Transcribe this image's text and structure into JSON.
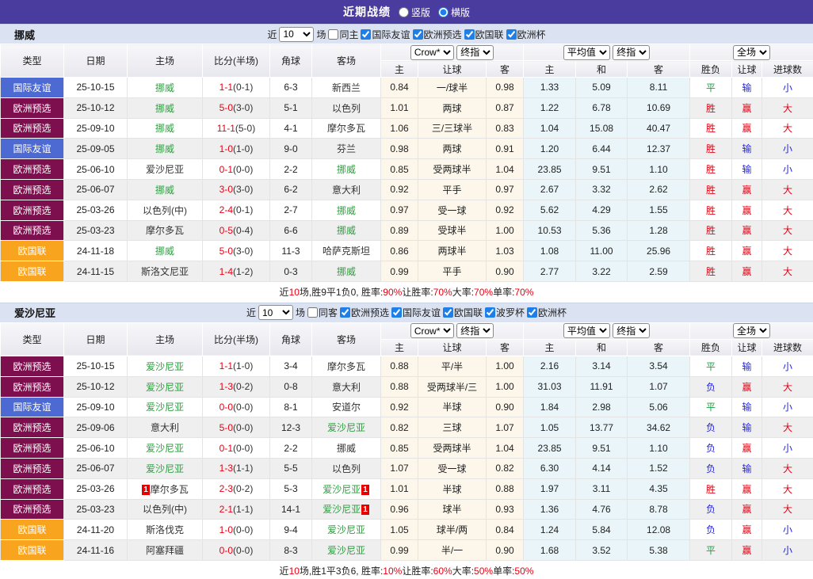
{
  "title_bar": {
    "title": "近期战绩",
    "options": [
      {
        "label": "竖版",
        "selected": false
      },
      {
        "label": "横版",
        "selected": true
      }
    ]
  },
  "colors": {
    "title_bg": "#4a3c9f",
    "filter_bg": "#dbe2f1",
    "type_friendly": "#4d6ad3",
    "type_qualifier": "#7e0f4e",
    "type_nations": "#f8a41e",
    "focus_team": "#2f9e41",
    "win_red": "#e60012",
    "lose_blue": "#2626d8",
    "draw_green": "#1d9e3e",
    "odds_bg": "#fcf7ea",
    "avg_bg": "#e9f5f9"
  },
  "table_header": {
    "static": [
      "类型",
      "日期",
      "主场",
      "比分(半场)",
      "角球",
      "客场"
    ],
    "selects": {
      "crow": "Crow*",
      "final1": "终指",
      "avg": "平均值",
      "final2": "终指",
      "scope": "全场"
    },
    "sub": [
      "主",
      "让球",
      "客",
      "主",
      "和",
      "客",
      "胜负",
      "让球",
      "进球数"
    ]
  },
  "tables": [
    {
      "team": "挪威",
      "filter": {
        "near_label": "近",
        "count": "10",
        "games_label": "场",
        "same_label": "同主",
        "same_checked": false,
        "leagues": [
          {
            "label": "国际友谊",
            "checked": true
          },
          {
            "label": "欧洲预选",
            "checked": true
          },
          {
            "label": "欧国联",
            "checked": true
          },
          {
            "label": "欧洲杯",
            "checked": true
          }
        ]
      },
      "rows": [
        {
          "type": "国际友谊",
          "type_color": "blue",
          "date": "25-10-15",
          "home": "挪威",
          "home_focus": true,
          "home_card": "",
          "score": "1-1",
          "half": "(0-1)",
          "corner": "6-3",
          "away": "新西兰",
          "away_focus": false,
          "away_card": "",
          "crow": [
            "0.84",
            "一/球半",
            "0.98"
          ],
          "avg": [
            "1.33",
            "5.09",
            "8.11"
          ],
          "outcome": [
            [
              "平",
              "g"
            ],
            [
              "输",
              "b"
            ],
            [
              "小",
              "b"
            ]
          ]
        },
        {
          "type": "欧洲预选",
          "type_color": "maroon",
          "date": "25-10-12",
          "home": "挪威",
          "home_focus": true,
          "home_card": "",
          "score": "5-0",
          "half": "(3-0)",
          "corner": "5-1",
          "away": "以色列",
          "away_focus": false,
          "away_card": "",
          "crow": [
            "1.01",
            "两球",
            "0.87"
          ],
          "avg": [
            "1.22",
            "6.78",
            "10.69"
          ],
          "outcome": [
            [
              "胜",
              "r"
            ],
            [
              "赢",
              "r"
            ],
            [
              "大",
              "r"
            ]
          ]
        },
        {
          "type": "欧洲预选",
          "type_color": "maroon",
          "date": "25-09-10",
          "home": "挪威",
          "home_focus": true,
          "home_card": "",
          "score": "11-1",
          "half": "(5-0)",
          "corner": "4-1",
          "away": "摩尔多瓦",
          "away_focus": false,
          "away_card": "",
          "crow": [
            "1.06",
            "三/三球半",
            "0.83"
          ],
          "avg": [
            "1.04",
            "15.08",
            "40.47"
          ],
          "outcome": [
            [
              "胜",
              "r"
            ],
            [
              "赢",
              "r"
            ],
            [
              "大",
              "r"
            ]
          ]
        },
        {
          "type": "国际友谊",
          "type_color": "blue",
          "date": "25-09-05",
          "home": "挪威",
          "home_focus": true,
          "home_card": "",
          "score": "1-0",
          "half": "(1-0)",
          "corner": "9-0",
          "away": "芬兰",
          "away_focus": false,
          "away_card": "",
          "crow": [
            "0.98",
            "两球",
            "0.91"
          ],
          "avg": [
            "1.20",
            "6.44",
            "12.37"
          ],
          "outcome": [
            [
              "胜",
              "r"
            ],
            [
              "输",
              "b"
            ],
            [
              "小",
              "b"
            ]
          ]
        },
        {
          "type": "欧洲预选",
          "type_color": "maroon",
          "date": "25-06-10",
          "home": "爱沙尼亚",
          "home_focus": false,
          "home_card": "",
          "score": "0-1",
          "half": "(0-0)",
          "corner": "2-2",
          "away": "挪威",
          "away_focus": true,
          "away_card": "",
          "crow": [
            "0.85",
            "受两球半",
            "1.04"
          ],
          "avg": [
            "23.85",
            "9.51",
            "1.10"
          ],
          "outcome": [
            [
              "胜",
              "r"
            ],
            [
              "输",
              "b"
            ],
            [
              "小",
              "b"
            ]
          ]
        },
        {
          "type": "欧洲预选",
          "type_color": "maroon",
          "date": "25-06-07",
          "home": "挪威",
          "home_focus": true,
          "home_card": "",
          "score": "3-0",
          "half": "(3-0)",
          "corner": "6-2",
          "away": "意大利",
          "away_focus": false,
          "away_card": "",
          "crow": [
            "0.92",
            "平手",
            "0.97"
          ],
          "avg": [
            "2.67",
            "3.32",
            "2.62"
          ],
          "outcome": [
            [
              "胜",
              "r"
            ],
            [
              "赢",
              "r"
            ],
            [
              "大",
              "r"
            ]
          ]
        },
        {
          "type": "欧洲预选",
          "type_color": "maroon",
          "date": "25-03-26",
          "home": "以色列(中)",
          "home_focus": false,
          "home_card": "",
          "score": "2-4",
          "half": "(0-1)",
          "corner": "2-7",
          "away": "挪威",
          "away_focus": true,
          "away_card": "",
          "crow": [
            "0.97",
            "受一球",
            "0.92"
          ],
          "avg": [
            "5.62",
            "4.29",
            "1.55"
          ],
          "outcome": [
            [
              "胜",
              "r"
            ],
            [
              "赢",
              "r"
            ],
            [
              "大",
              "r"
            ]
          ]
        },
        {
          "type": "欧洲预选",
          "type_color": "maroon",
          "date": "25-03-23",
          "home": "摩尔多瓦",
          "home_focus": false,
          "home_card": "",
          "score": "0-5",
          "half": "(0-4)",
          "corner": "6-6",
          "away": "挪威",
          "away_focus": true,
          "away_card": "",
          "crow": [
            "0.89",
            "受球半",
            "1.00"
          ],
          "avg": [
            "10.53",
            "5.36",
            "1.28"
          ],
          "outcome": [
            [
              "胜",
              "r"
            ],
            [
              "赢",
              "r"
            ],
            [
              "大",
              "r"
            ]
          ]
        },
        {
          "type": "欧国联",
          "type_color": "orange",
          "date": "24-11-18",
          "home": "挪威",
          "home_focus": true,
          "home_card": "",
          "score": "5-0",
          "half": "(3-0)",
          "corner": "11-3",
          "away": "哈萨克斯坦",
          "away_focus": false,
          "away_card": "",
          "crow": [
            "0.86",
            "两球半",
            "1.03"
          ],
          "avg": [
            "1.08",
            "11.00",
            "25.96"
          ],
          "outcome": [
            [
              "胜",
              "r"
            ],
            [
              "赢",
              "r"
            ],
            [
              "大",
              "r"
            ]
          ]
        },
        {
          "type": "欧国联",
          "type_color": "orange",
          "date": "24-11-15",
          "home": "斯洛文尼亚",
          "home_focus": false,
          "home_card": "",
          "score": "1-4",
          "half": "(1-2)",
          "corner": "0-3",
          "away": "挪威",
          "away_focus": true,
          "away_card": "",
          "crow": [
            "0.99",
            "平手",
            "0.90"
          ],
          "avg": [
            "2.77",
            "3.22",
            "2.59"
          ],
          "outcome": [
            [
              "胜",
              "r"
            ],
            [
              "赢",
              "r"
            ],
            [
              "大",
              "r"
            ]
          ]
        }
      ],
      "summary": [
        {
          "text": "近",
          "hl": false
        },
        {
          "text": "10",
          "hl": true
        },
        {
          "text": "场,胜9平1负0, 胜率:",
          "hl": false
        },
        {
          "text": "90%",
          "hl": true
        },
        {
          "text": " 让胜率:",
          "hl": false
        },
        {
          "text": "70%",
          "hl": true
        },
        {
          "text": " 大率:",
          "hl": false
        },
        {
          "text": "70%",
          "hl": true
        },
        {
          "text": " 单率:",
          "hl": false
        },
        {
          "text": "70%",
          "hl": true
        }
      ]
    },
    {
      "team": "爱沙尼亚",
      "filter": {
        "near_label": "近",
        "count": "10",
        "games_label": "场",
        "same_label": "同客",
        "same_checked": false,
        "leagues": [
          {
            "label": "欧洲预选",
            "checked": true
          },
          {
            "label": "国际友谊",
            "checked": true
          },
          {
            "label": "欧国联",
            "checked": true
          },
          {
            "label": "波罗杯",
            "checked": true
          },
          {
            "label": "欧洲杯",
            "checked": true
          }
        ]
      },
      "rows": [
        {
          "type": "欧洲预选",
          "type_color": "maroon",
          "date": "25-10-15",
          "home": "爱沙尼亚",
          "home_focus": true,
          "home_card": "",
          "score": "1-1",
          "half": "(1-0)",
          "corner": "3-4",
          "away": "摩尔多瓦",
          "away_focus": false,
          "away_card": "",
          "crow": [
            "0.88",
            "平/半",
            "1.00"
          ],
          "avg": [
            "2.16",
            "3.14",
            "3.54"
          ],
          "outcome": [
            [
              "平",
              "g"
            ],
            [
              "输",
              "b"
            ],
            [
              "小",
              "b"
            ]
          ]
        },
        {
          "type": "欧洲预选",
          "type_color": "maroon",
          "date": "25-10-12",
          "home": "爱沙尼亚",
          "home_focus": true,
          "home_card": "",
          "score": "1-3",
          "half": "(0-2)",
          "corner": "0-8",
          "away": "意大利",
          "away_focus": false,
          "away_card": "",
          "crow": [
            "0.88",
            "受两球半/三",
            "1.00"
          ],
          "avg": [
            "31.03",
            "11.91",
            "1.07"
          ],
          "outcome": [
            [
              "负",
              "b"
            ],
            [
              "赢",
              "r"
            ],
            [
              "大",
              "r"
            ]
          ]
        },
        {
          "type": "国际友谊",
          "type_color": "blue",
          "date": "25-09-10",
          "home": "爱沙尼亚",
          "home_focus": true,
          "home_card": "",
          "score": "0-0",
          "half": "(0-0)",
          "corner": "8-1",
          "away": "安道尔",
          "away_focus": false,
          "away_card": "",
          "crow": [
            "0.92",
            "半球",
            "0.90"
          ],
          "avg": [
            "1.84",
            "2.98",
            "5.06"
          ],
          "outcome": [
            [
              "平",
              "g"
            ],
            [
              "输",
              "b"
            ],
            [
              "小",
              "b"
            ]
          ]
        },
        {
          "type": "欧洲预选",
          "type_color": "maroon",
          "date": "25-09-06",
          "home": "意大利",
          "home_focus": false,
          "home_card": "",
          "score": "5-0",
          "half": "(0-0)",
          "corner": "12-3",
          "away": "爱沙尼亚",
          "away_focus": true,
          "away_card": "",
          "crow": [
            "0.82",
            "三球",
            "1.07"
          ],
          "avg": [
            "1.05",
            "13.77",
            "34.62"
          ],
          "outcome": [
            [
              "负",
              "b"
            ],
            [
              "输",
              "b"
            ],
            [
              "大",
              "r"
            ]
          ]
        },
        {
          "type": "欧洲预选",
          "type_color": "maroon",
          "date": "25-06-10",
          "home": "爱沙尼亚",
          "home_focus": true,
          "home_card": "",
          "score": "0-1",
          "half": "(0-0)",
          "corner": "2-2",
          "away": "挪威",
          "away_focus": false,
          "away_card": "",
          "crow": [
            "0.85",
            "受两球半",
            "1.04"
          ],
          "avg": [
            "23.85",
            "9.51",
            "1.10"
          ],
          "outcome": [
            [
              "负",
              "b"
            ],
            [
              "赢",
              "r"
            ],
            [
              "小",
              "b"
            ]
          ]
        },
        {
          "type": "欧洲预选",
          "type_color": "maroon",
          "date": "25-06-07",
          "home": "爱沙尼亚",
          "home_focus": true,
          "home_card": "",
          "score": "1-3",
          "half": "(1-1)",
          "corner": "5-5",
          "away": "以色列",
          "away_focus": false,
          "away_card": "",
          "crow": [
            "1.07",
            "受一球",
            "0.82"
          ],
          "avg": [
            "6.30",
            "4.14",
            "1.52"
          ],
          "outcome": [
            [
              "负",
              "b"
            ],
            [
              "输",
              "b"
            ],
            [
              "大",
              "r"
            ]
          ]
        },
        {
          "type": "欧洲预选",
          "type_color": "maroon",
          "date": "25-03-26",
          "home": "摩尔多瓦",
          "home_focus": false,
          "home_card": "1",
          "score": "2-3",
          "half": "(0-2)",
          "corner": "5-3",
          "away": "爱沙尼亚",
          "away_focus": true,
          "away_card": "1",
          "crow": [
            "1.01",
            "半球",
            "0.88"
          ],
          "avg": [
            "1.97",
            "3.11",
            "4.35"
          ],
          "outcome": [
            [
              "胜",
              "r"
            ],
            [
              "赢",
              "r"
            ],
            [
              "大",
              "r"
            ]
          ]
        },
        {
          "type": "欧洲预选",
          "type_color": "maroon",
          "date": "25-03-23",
          "home": "以色列(中)",
          "home_focus": false,
          "home_card": "",
          "score": "2-1",
          "half": "(1-1)",
          "corner": "14-1",
          "away": "爱沙尼亚",
          "away_focus": true,
          "away_card": "1",
          "crow": [
            "0.96",
            "球半",
            "0.93"
          ],
          "avg": [
            "1.36",
            "4.76",
            "8.78"
          ],
          "outcome": [
            [
              "负",
              "b"
            ],
            [
              "赢",
              "r"
            ],
            [
              "大",
              "r"
            ]
          ]
        },
        {
          "type": "欧国联",
          "type_color": "orange",
          "date": "24-11-20",
          "home": "斯洛伐克",
          "home_focus": false,
          "home_card": "",
          "score": "1-0",
          "half": "(0-0)",
          "corner": "9-4",
          "away": "爱沙尼亚",
          "away_focus": true,
          "away_card": "",
          "crow": [
            "1.05",
            "球半/两",
            "0.84"
          ],
          "avg": [
            "1.24",
            "5.84",
            "12.08"
          ],
          "outcome": [
            [
              "负",
              "b"
            ],
            [
              "赢",
              "r"
            ],
            [
              "小",
              "b"
            ]
          ]
        },
        {
          "type": "欧国联",
          "type_color": "orange",
          "date": "24-11-16",
          "home": "阿塞拜疆",
          "home_focus": false,
          "home_card": "",
          "score": "0-0",
          "half": "(0-0)",
          "corner": "8-3",
          "away": "爱沙尼亚",
          "away_focus": true,
          "away_card": "",
          "crow": [
            "0.99",
            "半/一",
            "0.90"
          ],
          "avg": [
            "1.68",
            "3.52",
            "5.38"
          ],
          "outcome": [
            [
              "平",
              "g"
            ],
            [
              "赢",
              "r"
            ],
            [
              "小",
              "b"
            ]
          ]
        }
      ],
      "summary": [
        {
          "text": "近",
          "hl": false
        },
        {
          "text": "10",
          "hl": true
        },
        {
          "text": "场,胜1平3负6, 胜率:",
          "hl": false
        },
        {
          "text": "10%",
          "hl": true
        },
        {
          "text": " 让胜率:",
          "hl": false
        },
        {
          "text": "60%",
          "hl": true
        },
        {
          "text": " 大率:",
          "hl": false
        },
        {
          "text": "50%",
          "hl": true
        },
        {
          "text": " 单率:",
          "hl": false
        },
        {
          "text": "50%",
          "hl": true
        }
      ]
    }
  ]
}
